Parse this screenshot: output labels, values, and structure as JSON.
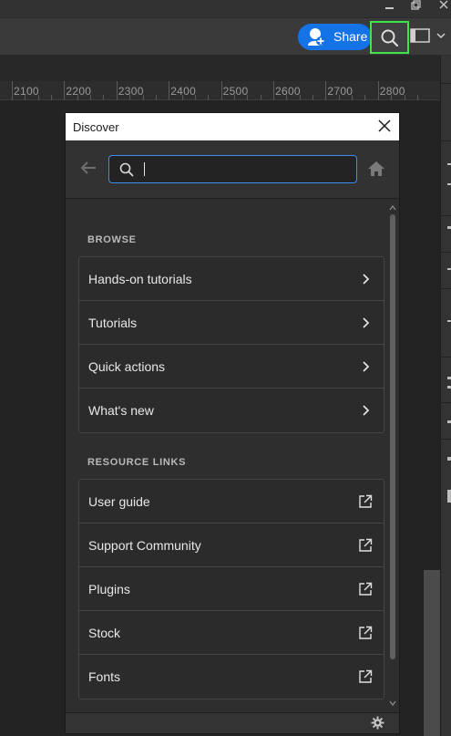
{
  "appbar": {
    "share_label": "Share"
  },
  "ruler": {
    "labels": [
      "2100",
      "2200",
      "2300",
      "2400",
      "2500",
      "2600",
      "2700",
      "2800"
    ]
  },
  "dialog": {
    "title": "Discover",
    "search": {
      "value": "",
      "placeholder": ""
    },
    "browse": {
      "heading": "BROWSE",
      "items": [
        {
          "label": "Hands-on tutorials",
          "icon": "chevron-right-icon"
        },
        {
          "label": "Tutorials",
          "icon": "chevron-right-icon"
        },
        {
          "label": "Quick actions",
          "icon": "chevron-right-icon"
        },
        {
          "label": "What's new",
          "icon": "chevron-right-icon"
        }
      ]
    },
    "resources": {
      "heading": "RESOURCE LINKS",
      "items": [
        {
          "label": "User guide",
          "icon": "external-link-icon"
        },
        {
          "label": "Support Community",
          "icon": "external-link-icon"
        },
        {
          "label": "Plugins",
          "icon": "external-link-icon"
        },
        {
          "label": "Stock",
          "icon": "external-link-icon"
        },
        {
          "label": "Fonts",
          "icon": "external-link-icon"
        }
      ]
    }
  },
  "colors": {
    "accent": "#1473e6",
    "focus_ring": "#3d8ef0",
    "highlight": "#3fe34a"
  }
}
